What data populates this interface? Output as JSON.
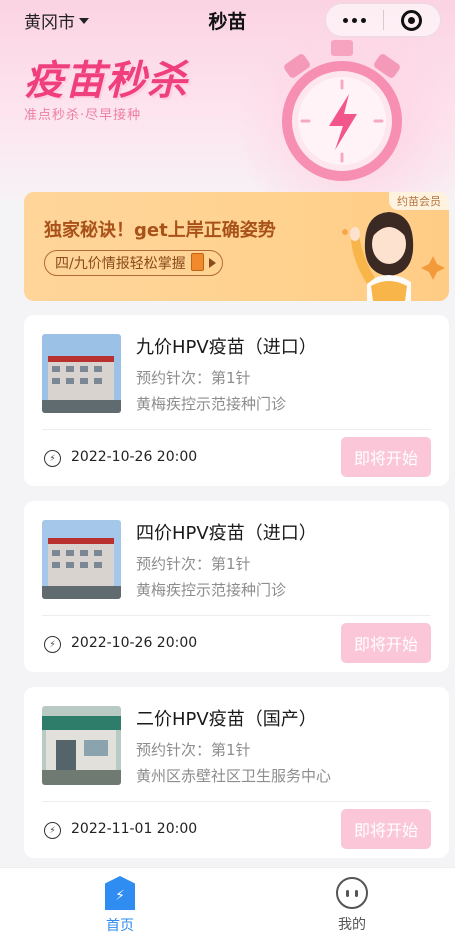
{
  "header": {
    "city": "黄冈市",
    "title": "秒苗",
    "banner_title": "疫苗秒杀",
    "banner_subtitle": "准点秒杀·尽早接种"
  },
  "promo": {
    "title": "独家秘诀！get上岸正确姿势",
    "pill": "四/九价情报轻松掌握",
    "tag": "约苗会员"
  },
  "vaccines": [
    {
      "name": "九价HPV疫苗（进口）",
      "dose": "预约针次：第1针",
      "clinic": "黄梅疾控示范接种门诊",
      "time": "2022-10-26 20:00",
      "button": "即将开始"
    },
    {
      "name": "四价HPV疫苗（进口）",
      "dose": "预约针次：第1针",
      "clinic": "黄梅疾控示范接种门诊",
      "time": "2022-10-26 20:00",
      "button": "即将开始"
    },
    {
      "name": "二价HPV疫苗（国产）",
      "dose": "预约针次：第1针",
      "clinic": "黄州区赤壁社区卫生服务中心",
      "time": "2022-11-01 20:00",
      "button": "即将开始"
    }
  ],
  "tabbar": {
    "home_label": "首页",
    "me_label": "我的"
  },
  "colors": {
    "accent": "#2f8cf0",
    "banner_pink": "#ef3f7c",
    "button_disabled": "#fbc7d8",
    "promo_bg": "#ffd59a"
  }
}
